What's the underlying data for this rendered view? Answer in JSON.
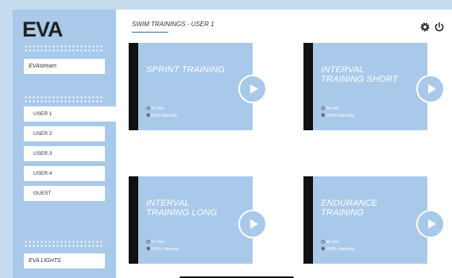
{
  "app": {
    "logo": "EVA"
  },
  "sidebar": {
    "stream_label": "EVAstream",
    "users": [
      "USER 1",
      "USER 2",
      "USER 3",
      "USER 4",
      "GUEST"
    ],
    "lights_label": "EVA LIGHTS"
  },
  "header": {
    "title": "SWIM TRAININGS - USER 1"
  },
  "cards": [
    {
      "title": "SPRINT TRAINING",
      "duration": "18 min",
      "intensity": "60% intensity"
    },
    {
      "title": "INTERVAL TRAINING SHORT",
      "duration": "24 min",
      "intensity": "100% intensity"
    },
    {
      "title": "INTERVAL TRAINING LONG",
      "duration": "37 min",
      "intensity": "100% intensity"
    },
    {
      "title": "ENDURANCE TRAINING",
      "duration": "48 min",
      "intensity": "100% intensity"
    }
  ],
  "icons": {
    "settings": "gear-icon",
    "power": "power-icon",
    "play": "play-icon",
    "clock": "clock-icon",
    "intensity": "radiation-icon"
  },
  "colors": {
    "accent": "#a9c9ea",
    "card_bar": "#111111",
    "background": "#ffffff"
  }
}
